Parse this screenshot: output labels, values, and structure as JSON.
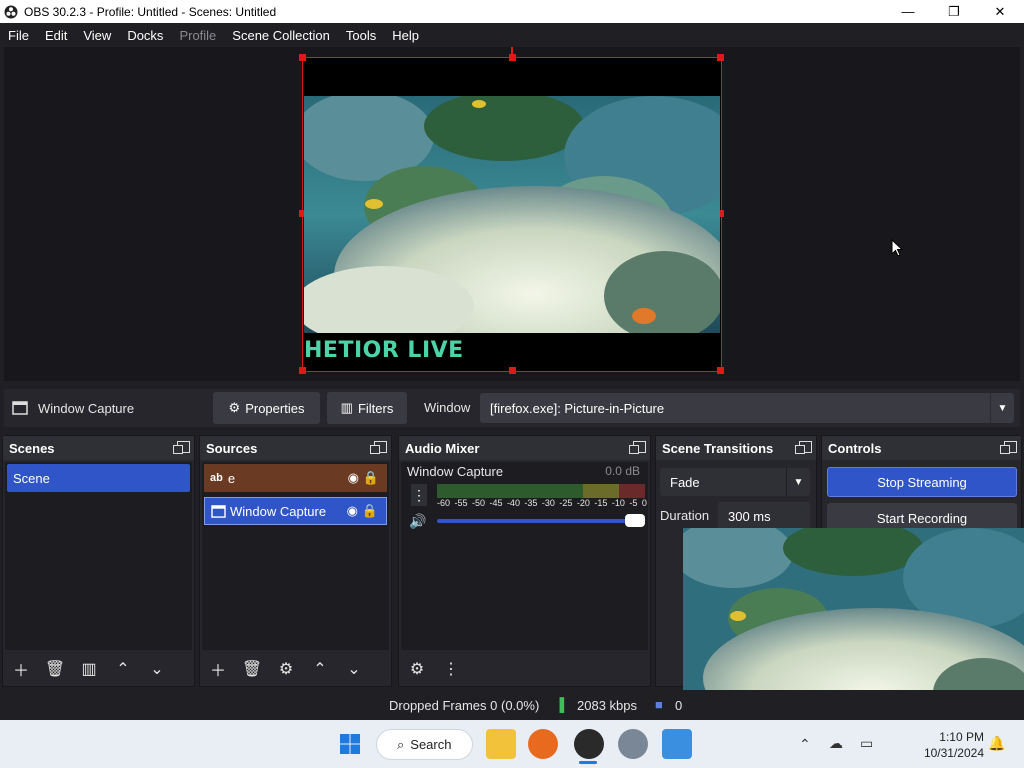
{
  "window": {
    "title": "OBS 30.2.3 - Profile: Untitled - Scenes: Untitled"
  },
  "menu": {
    "items": [
      "File",
      "Edit",
      "View",
      "Docks",
      "Profile",
      "Scene Collection",
      "Tools",
      "Help"
    ]
  },
  "preview": {
    "overlay_text": "HETIOR LIVE"
  },
  "source_toolbar": {
    "source_name": "Window Capture",
    "properties_label": "Properties",
    "filters_label": "Filters",
    "window_label": "Window",
    "window_value": "[firefox.exe]: Picture-in-Picture"
  },
  "scenes": {
    "title": "Scenes",
    "items": [
      "Scene"
    ]
  },
  "sources": {
    "title": "Sources",
    "items": [
      {
        "name": "e",
        "type": "text"
      },
      {
        "name": "Window Capture",
        "type": "window"
      }
    ]
  },
  "audio_mixer": {
    "title": "Audio Mixer",
    "channel": "Window Capture",
    "level": "0.0 dB",
    "ticks": [
      "-60",
      "-55",
      "-50",
      "-45",
      "-40",
      "-35",
      "-30",
      "-25",
      "-20",
      "-15",
      "-10",
      "-5",
      "0"
    ]
  },
  "transitions": {
    "title": "Scene Transitions",
    "type": "Fade",
    "duration_label": "Duration",
    "duration_value": "300 ms"
  },
  "controls": {
    "title": "Controls",
    "stop_streaming": "Stop Streaming",
    "start_recording": "Start Recording"
  },
  "status": {
    "dropped_frames": "Dropped Frames 0 (0.0%)",
    "bitrate": "2083 kbps",
    "extra": "0"
  },
  "taskbar": {
    "search_label": "Search",
    "time": "1:10 PM",
    "date": "10/31/2024"
  },
  "colors": {
    "accent": "#2f55c9",
    "selection": "#e01818",
    "source_text_bg": "#6b3a22"
  },
  "icons": [
    "obs-logo-icon",
    "minimize-icon",
    "maximize-icon",
    "close-icon",
    "window-capture-icon",
    "gear-icon",
    "filters-icon",
    "chevron-down-icon",
    "eye-icon",
    "lock-icon",
    "plus-icon",
    "trash-icon",
    "up-icon",
    "down-icon",
    "speaker-icon",
    "windows-start-icon",
    "search-icon"
  ]
}
